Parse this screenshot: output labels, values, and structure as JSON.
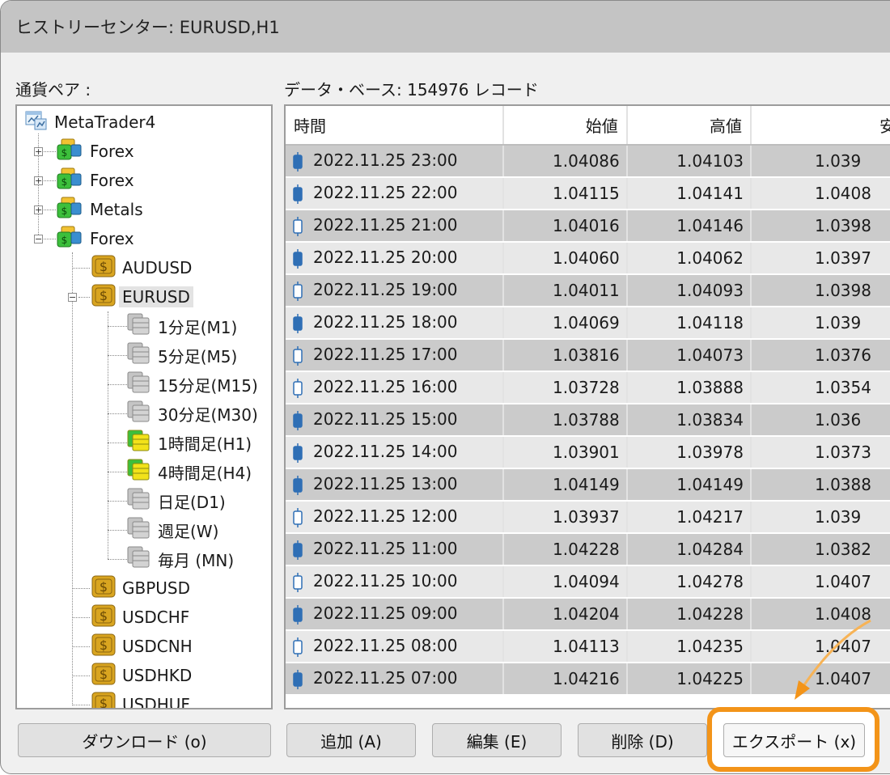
{
  "window": {
    "title": "ヒストリーセンター: EURUSD,H1"
  },
  "labels": {
    "pairs": "通貨ペア :",
    "database": "データ・ベース: 154976 レコード"
  },
  "tree": {
    "root": "MetaTrader4",
    "groups": [
      "Forex",
      "Forex",
      "Metals",
      "Forex"
    ],
    "symbols_before": [
      "AUDUSD"
    ],
    "selected_symbol": "EURUSD",
    "timeframes": [
      "1分足(M1)",
      "5分足(M5)",
      "15分足(M15)",
      "30分足(M30)",
      "1時間足(H1)",
      "4時間足(H4)",
      "日足(D1)",
      "週足(W)",
      "毎月 (MN)"
    ],
    "timeframes_with_data": [
      false,
      false,
      false,
      false,
      true,
      true,
      false,
      false,
      false
    ],
    "symbols_after": [
      "GBPUSD",
      "USDCHF",
      "USDCNH",
      "USDHKD",
      "USDHUF"
    ]
  },
  "table": {
    "columns": [
      "時間",
      "始値",
      "高値",
      "安値"
    ],
    "rows": [
      {
        "time": "2022.11.25 23:00",
        "open": "1.04086",
        "high": "1.04103",
        "low": "1.039",
        "bear": true
      },
      {
        "time": "2022.11.25 22:00",
        "open": "1.04115",
        "high": "1.04141",
        "low": "1.0408",
        "bear": true
      },
      {
        "time": "2022.11.25 21:00",
        "open": "1.04016",
        "high": "1.04146",
        "low": "1.0398",
        "bear": false
      },
      {
        "time": "2022.11.25 20:00",
        "open": "1.04060",
        "high": "1.04062",
        "low": "1.0397",
        "bear": true
      },
      {
        "time": "2022.11.25 19:00",
        "open": "1.04011",
        "high": "1.04093",
        "low": "1.0398",
        "bear": false
      },
      {
        "time": "2022.11.25 18:00",
        "open": "1.04069",
        "high": "1.04118",
        "low": "1.039",
        "bear": true
      },
      {
        "time": "2022.11.25 17:00",
        "open": "1.03816",
        "high": "1.04073",
        "low": "1.0376",
        "bear": false
      },
      {
        "time": "2022.11.25 16:00",
        "open": "1.03728",
        "high": "1.03888",
        "low": "1.0354",
        "bear": false
      },
      {
        "time": "2022.11.25 15:00",
        "open": "1.03788",
        "high": "1.03834",
        "low": "1.036",
        "bear": true
      },
      {
        "time": "2022.11.25 14:00",
        "open": "1.03901",
        "high": "1.03978",
        "low": "1.0373",
        "bear": true
      },
      {
        "time": "2022.11.25 13:00",
        "open": "1.04149",
        "high": "1.04149",
        "low": "1.0388",
        "bear": true
      },
      {
        "time": "2022.11.25 12:00",
        "open": "1.03937",
        "high": "1.04217",
        "low": "1.039",
        "bear": false
      },
      {
        "time": "2022.11.25 11:00",
        "open": "1.04228",
        "high": "1.04284",
        "low": "1.0382",
        "bear": true
      },
      {
        "time": "2022.11.25 10:00",
        "open": "1.04094",
        "high": "1.04278",
        "low": "1.0407",
        "bear": false
      },
      {
        "time": "2022.11.25 09:00",
        "open": "1.04204",
        "high": "1.04228",
        "low": "1.0408",
        "bear": true
      },
      {
        "time": "2022.11.25 08:00",
        "open": "1.04113",
        "high": "1.04235",
        "low": "1.0407",
        "bear": false
      },
      {
        "time": "2022.11.25 07:00",
        "open": "1.04216",
        "high": "1.04225",
        "low": "1.0407",
        "bear": true
      }
    ]
  },
  "buttons": {
    "download": "ダウンロード (o)",
    "add": "追加 (A)",
    "edit": "編集 (E)",
    "delete": "削除 (D)",
    "export": "エクスポート (x)"
  },
  "colors": {
    "highlight": "#f39419",
    "candle_bear": "#2f6fb5",
    "folder_green": "#3cbf3c",
    "coin_gold": "#d9a520"
  }
}
